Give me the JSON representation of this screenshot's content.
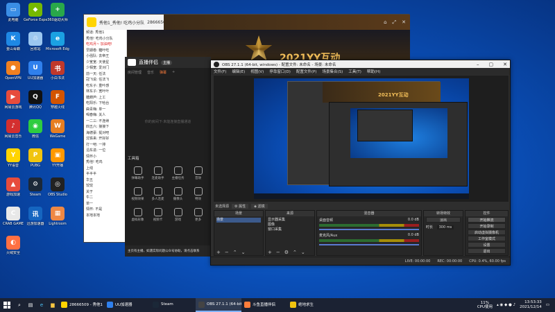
{
  "desktop": {
    "icons": [
      {
        "label": "此电脑",
        "color": "#3a8ee6",
        "glyph": "▭"
      },
      {
        "label": "GeForce Experience",
        "color": "#76b900",
        "glyph": "◆"
      },
      {
        "label": "360驱动大师",
        "color": "#29a84a",
        "glyph": "+"
      },
      {
        "label": "金山毒霸",
        "color": "#1e88e5",
        "glyph": "K"
      },
      {
        "label": "回收站",
        "color": "#9cc7f0",
        "glyph": "♲"
      },
      {
        "label": "Microsoft Edge",
        "color": "#1ba1e2",
        "glyph": "e"
      },
      {
        "label": "OpenVPN",
        "color": "#f08020",
        "glyph": "●"
      },
      {
        "label": "UU加速器",
        "color": "#2f80ed",
        "glyph": "U"
      },
      {
        "label": "小白书法",
        "color": "#c0392b",
        "glyph": "书"
      },
      {
        "label": "网易云游戏",
        "color": "#e74c3c",
        "glyph": "▶"
      },
      {
        "label": "腾讯QQ",
        "color": "#111",
        "glyph": "Q"
      },
      {
        "label": "穿越火线",
        "color": "#d35400",
        "glyph": "F"
      },
      {
        "label": "网易云音乐",
        "color": "#d32f2f",
        "glyph": "♪"
      },
      {
        "label": "微信",
        "color": "#2ecc40",
        "glyph": "◉"
      },
      {
        "label": "WeGame",
        "color": "#e67e22",
        "glyph": "W"
      },
      {
        "label": "YY语音",
        "color": "#ffd400",
        "glyph": "Y"
      },
      {
        "label": "PUBG",
        "color": "#f1c40f",
        "glyph": "P"
      },
      {
        "label": "YY开播",
        "color": "#ff9800",
        "glyph": "▣"
      },
      {
        "label": "游戏加速",
        "color": "#e74c3c",
        "glyph": "▲"
      },
      {
        "label": "Steam",
        "color": "#1b2838",
        "glyph": "⚙"
      },
      {
        "label": "OBS Studio",
        "color": "#222",
        "glyph": "◎"
      },
      {
        "label": "CRAB GAME",
        "color": "#e8e8e8",
        "glyph": "C"
      },
      {
        "label": "迅游加速器",
        "color": "#1565c0",
        "glyph": "讯"
      },
      {
        "label": "Lightroom",
        "color": "#e84",
        "glyph": "▦"
      },
      {
        "label": "火绒安全",
        "color": "#ff7043",
        "glyph": "◐"
      }
    ]
  },
  "yy_window": {
    "title": "秀他1_秀他! 吃鸡小分队",
    "room_id": "28666509",
    "online_count": "2",
    "banner_text": "2021YY互动",
    "sidebar_rows": [
      "频道: 秀他1",
      "秀他! 吃鸡小分队",
      "吃鸡月~ 加油吧!",
      "早期卷: 糖叶吃",
      "小强队: 去帝王",
      "少宽宽: 天使星",
      "少相宽: 爱对门",
      "前一天: 任法",
      "冠飞说: 任法飞",
      "吃东子: 重叶感",
      "林东子: 宽叶叶",
      "糖葫芦: 上工",
      "吃阳乐: 下哈台",
      "曲青嗨: 单一",
      "喝春嗨: 关人",
      "一二三: 不连续",
      "四五六: 接接下",
      "海德豪: 挺对吧",
      "沈铁来: 开好好",
      "打一吧: 一排",
      "沿东进: 一位",
      "情怀小",
      "秀他! 吃鸡",
      "上线",
      "半半半",
      "华五",
      "饺饺",
      "关于",
      "牛二",
      "单一",
      "情怀: 不是",
      "本地本地"
    ]
  },
  "live_assistant": {
    "title": "直播伴侣",
    "badge": "主播",
    "tabs": [
      "房间管理",
      "音乐",
      "弹幕",
      "+"
    ],
    "active_tab": 2,
    "empty_text": "你的房间下·未能连接直播通道",
    "tools_header": "工具箱",
    "tools": [
      "弹幕助手",
      "连麦助手",
      "主播任务",
      "音效",
      "视频效果",
      "多人连麦",
      "摄像头",
      "特效",
      "虚拟形象",
      "视频卡",
      "游戏",
      "更多"
    ],
    "footer": "主页有主播，如遇实际问题公众号协助，请点击联系"
  },
  "obs": {
    "title": "OBS 27.1.1 (64-bit, windows) - 配置文件: 未命名 - 场景: 未命名",
    "menu": [
      "文件(F)",
      "编辑(E)",
      "视图(V)",
      "停靠窗口(D)",
      "配置文件(P)",
      "场景集合(S)",
      "工具(T)",
      "帮助(H)"
    ],
    "scene_bar_label": "未选择源",
    "scene_bar_props": "属性",
    "scene_bar_filters": "滤镜",
    "docks": {
      "scenes": {
        "header": "场景",
        "items": [
          "场景"
        ]
      },
      "sources": {
        "header": "来源",
        "items": [
          "显示器采集",
          "图像",
          "窗口采集"
        ]
      },
      "mixer": {
        "header": "混音器",
        "channels": [
          {
            "name": "桌面音频",
            "db": "0.0 dB"
          },
          {
            "name": "麦克风/Aux",
            "db": "0.0 dB"
          }
        ]
      },
      "transitions": {
        "header": "转场特效",
        "type": "淡出",
        "duration_label": "时长",
        "duration": "300 ms"
      },
      "controls": {
        "header": "控件",
        "buttons": [
          "开始推流",
          "开始录制",
          "启动虚拟摄像机",
          "工作室模式",
          "设置",
          "退出"
        ]
      }
    },
    "status": {
      "live": "LIVE: 00:00:00",
      "rec": "REC: 00:00:00",
      "cpu": "CPU: 0.4%, 60.00 fps"
    }
  },
  "taskbar": {
    "apps": [
      {
        "label": "28666509 - 秀他1",
        "color": "#ffd400",
        "active": false
      },
      {
        "label": "UU加速器",
        "color": "#2f80ed",
        "active": false
      },
      {
        "label": "Steam",
        "color": "#1b2838",
        "active": false
      },
      {
        "label": "OBS 27.1.1 (64-bit)",
        "color": "#444",
        "active": true
      },
      {
        "label": "斗鱼直播伴侣",
        "color": "#ff7d3b",
        "active": false
      },
      {
        "label": "绝地求生",
        "color": "#f1c40f",
        "active": false
      }
    ],
    "cpu_value": "11%",
    "cpu_label": "CPU使用",
    "time": "13:53:33",
    "date": "2021/12/14"
  }
}
